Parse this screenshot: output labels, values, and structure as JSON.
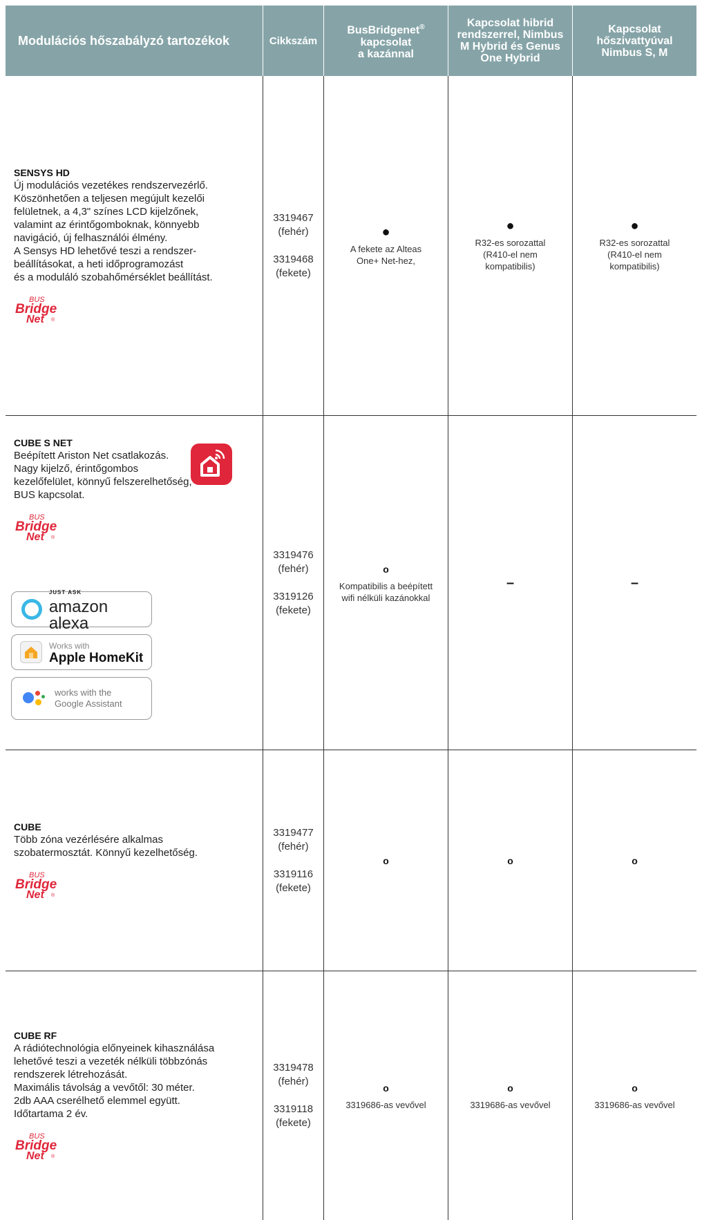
{
  "header": {
    "col1": "Modulációs hőszabályzó tartozékok",
    "col2": "Cikkszám",
    "col3": "BusBridgenet",
    "col3_sup": "®",
    "col3_rest": "kapcsolat\na kazánnal",
    "col4": "Kapcsolat hibrid\nrendszerrel, Nimbus\nM Hybrid és Genus\nOne Hybrid",
    "col5": "Kapcsolat\nhőszivattyúval\nNimbus S, M"
  },
  "brand": {
    "bus": "BUS",
    "bridge": "Bridge",
    "net": "Net",
    "reg": "®",
    "color": "#e0263a"
  },
  "rows": [
    {
      "name": "SENSYS HD",
      "text": "Új modulációs vezetékes rendszervezérlő.\nKöszönhetően a teljesen megújult kezelői\nfelületnek, a 4,3\" színes LCD kijelzőnek,\nvalamint az érintőgomboknak, könnyebb\nnavigáció, új felhasználói élmény.\nA Sensys HD lehetővé teszi a rendszer-\nbeállításokat, a heti időprogramozást\nés a moduláló szobahőmérséklet beállítást.",
      "code1": "3319467",
      "code1_note": "(fehér)",
      "code2": "3319468",
      "code2_note": "(fekete)",
      "c3_mark": "●",
      "c3_note": "A fekete az Alteas\nOne+ Net-hez,",
      "c4_mark": "●",
      "c4_note": "R32-es sorozattal\n(R410-el nem\nkompatibilis)",
      "c5_mark": "●",
      "c5_note": "R32-es sorozattal\n(R410-el nem\nkompatibilis)"
    },
    {
      "name": "CUBE S NET",
      "text": "Beépített Ariston Net csatlakozás.\nNagy kijelző, érintőgombos\nkezelőfelület, könnyű felszerelhetőség,\nBUS kapcsolat.",
      "code1": "3319476",
      "code1_note": "(fehér)",
      "code2": "3319126",
      "code2_note": "(fekete)",
      "c3_mark": "o",
      "c3_note": "Kompatibilis a beépített\nwifi nélküli kazánokkal",
      "c4_mark": "–",
      "c5_mark": "–",
      "app_icon": "smart-home-app-icon",
      "badges": {
        "alexa_small": "JUST ASK",
        "alexa_big": "amazon alexa",
        "homekit_small": "Works with",
        "homekit_big": "Apple HomeKit",
        "google_line1": "works with the",
        "google_line2": "Google Assistant"
      }
    },
    {
      "name": "CUBE",
      "text": "Több zóna vezérlésére alkalmas\nszobatermosztát. Könnyű kezelhetőség.",
      "code1": "3319477",
      "code1_note": "(fehér)",
      "code2": "3319116",
      "code2_note": "(fekete)",
      "c3_mark": "o",
      "c4_mark": "o",
      "c5_mark": "o"
    },
    {
      "name": "CUBE RF",
      "text": "A rádiótechnológia előnyeinek kihasználása\nlehetővé teszi a vezeték nélküli többzónás\nrendszerek létrehozását.\nMaximális távolság a vevőtől: 30 méter.\n2db AAA cserélhető elemmel együtt.\nIdőtartama 2 év.",
      "code1": "3319478",
      "code1_note": "(fehér)",
      "code2": "3319118",
      "code2_note": "(fekete)",
      "c3_mark": "o",
      "c3_note": "3319686-as vevővel",
      "c4_mark": "o",
      "c4_note": "3319686-as vevővel",
      "c5_mark": "o",
      "c5_note": "3319686-as vevővel"
    }
  ],
  "colors": {
    "header_bg": "#86a4a8",
    "alexa_blue": "#3ab7e6",
    "google_blue": "#4285f4",
    "google_red": "#ea4335",
    "google_yellow": "#fbbc05",
    "google_green": "#34a853"
  }
}
